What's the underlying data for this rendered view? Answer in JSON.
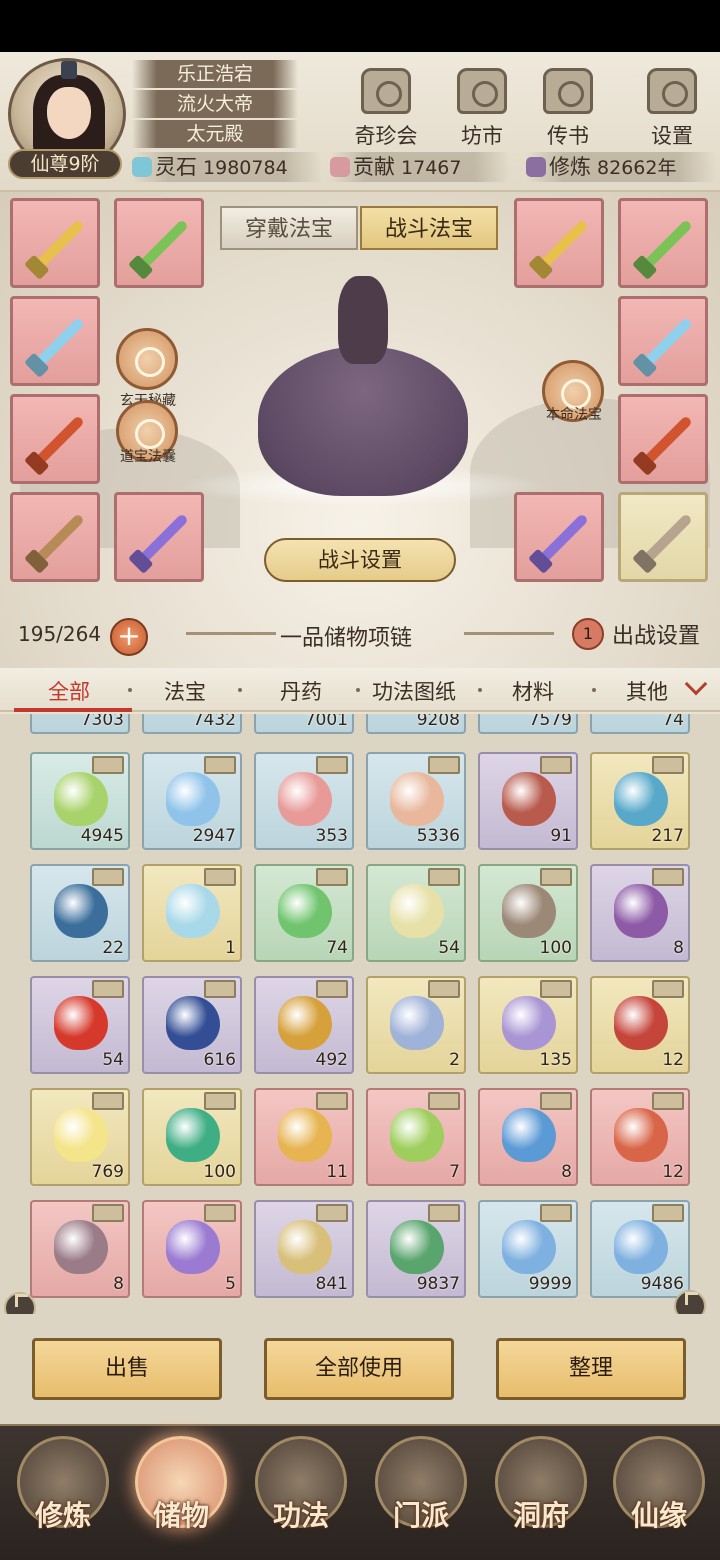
{
  "player": {
    "rank": "仙尊9阶",
    "names": [
      "乐正浩宕",
      "流火大帝",
      "太元殿"
    ]
  },
  "top_menu": [
    {
      "label": "奇珍会",
      "icon": "pavilion-icon"
    },
    {
      "label": "坊市",
      "icon": "market-icon"
    },
    {
      "label": "传书",
      "icon": "scroll-icon"
    },
    {
      "label": "设置",
      "icon": "gear-icon"
    }
  ],
  "resources": [
    {
      "name": "灵石",
      "value": "1980784",
      "color": "#7fc6d6"
    },
    {
      "name": "贡献",
      "value": "17467",
      "color": "#d79aa0"
    },
    {
      "name": "修炼",
      "value": "82662年",
      "color": "#8a6fa0"
    }
  ],
  "equip_tabs": [
    "穿戴法宝",
    "战斗法宝"
  ],
  "left_icons": [
    "玄天秘藏",
    "道宝法囊"
  ],
  "right_icon": "本命法宝",
  "fight_settings": "战斗设置",
  "capacity": "195/264",
  "capacity_item": "一品储物项链",
  "deploy_count": "1",
  "deploy_label": "出战设置",
  "filter_tabs": [
    "全部",
    "法宝",
    "丹药",
    "功法图纸",
    "材料",
    "其他"
  ],
  "partial_row": [
    "7303",
    "7432",
    "7001",
    "9208",
    "7579",
    "74"
  ],
  "items": [
    {
      "count": "4945",
      "color": "teal",
      "obj": "#a8d26a"
    },
    {
      "count": "2947",
      "color": "blue",
      "obj": "#8fc3ea"
    },
    {
      "count": "353",
      "color": "blue",
      "obj": "#e79a98"
    },
    {
      "count": "5336",
      "color": "blue",
      "obj": "#e8b79c"
    },
    {
      "count": "91",
      "color": "purple",
      "obj": "#b85a4c"
    },
    {
      "count": "217",
      "color": "gold",
      "obj": "#58a9c9"
    },
    {
      "count": "22",
      "color": "blue",
      "obj": "#3b6e9b"
    },
    {
      "count": "1",
      "color": "gold",
      "obj": "#a9d9e9"
    },
    {
      "count": "74",
      "color": "green",
      "obj": "#6fc46d"
    },
    {
      "count": "54",
      "color": "green",
      "obj": "#e7e1a8"
    },
    {
      "count": "100",
      "color": "green",
      "obj": "#9c8877"
    },
    {
      "count": "8",
      "color": "purple",
      "obj": "#8c5aa6"
    },
    {
      "count": "54",
      "color": "purple",
      "obj": "#d6392b"
    },
    {
      "count": "616",
      "color": "purple",
      "obj": "#334e95"
    },
    {
      "count": "492",
      "color": "purple",
      "obj": "#d6a03b"
    },
    {
      "count": "2",
      "color": "gold",
      "obj": "#9fb2d8"
    },
    {
      "count": "135",
      "color": "gold",
      "obj": "#a995d3"
    },
    {
      "count": "12",
      "color": "gold",
      "obj": "#c5453b"
    },
    {
      "count": "769",
      "color": "gold",
      "obj": "#f4e48a"
    },
    {
      "count": "100",
      "color": "gold",
      "obj": "#3fae85"
    },
    {
      "count": "11",
      "color": "red",
      "obj": "#e7b452"
    },
    {
      "count": "7",
      "color": "red",
      "obj": "#9fce5e"
    },
    {
      "count": "8",
      "color": "red",
      "obj": "#5c9ad6"
    },
    {
      "count": "12",
      "color": "red",
      "obj": "#d86548"
    },
    {
      "count": "8",
      "color": "red",
      "obj": "#9a7c88"
    },
    {
      "count": "5",
      "color": "red",
      "obj": "#9b7bd2"
    },
    {
      "count": "841",
      "color": "purple",
      "obj": "#d8bf7a"
    },
    {
      "count": "9837",
      "color": "purple",
      "obj": "#5aa56e"
    },
    {
      "count": "9999",
      "color": "blue",
      "obj": "#7fb1e0"
    },
    {
      "count": "9486",
      "color": "blue",
      "obj": "#7fb1e0"
    }
  ],
  "actions": [
    "出售",
    "全部使用",
    "整理"
  ],
  "nav": [
    "修炼",
    "储物",
    "功法",
    "门派",
    "洞府",
    "仙缘"
  ]
}
